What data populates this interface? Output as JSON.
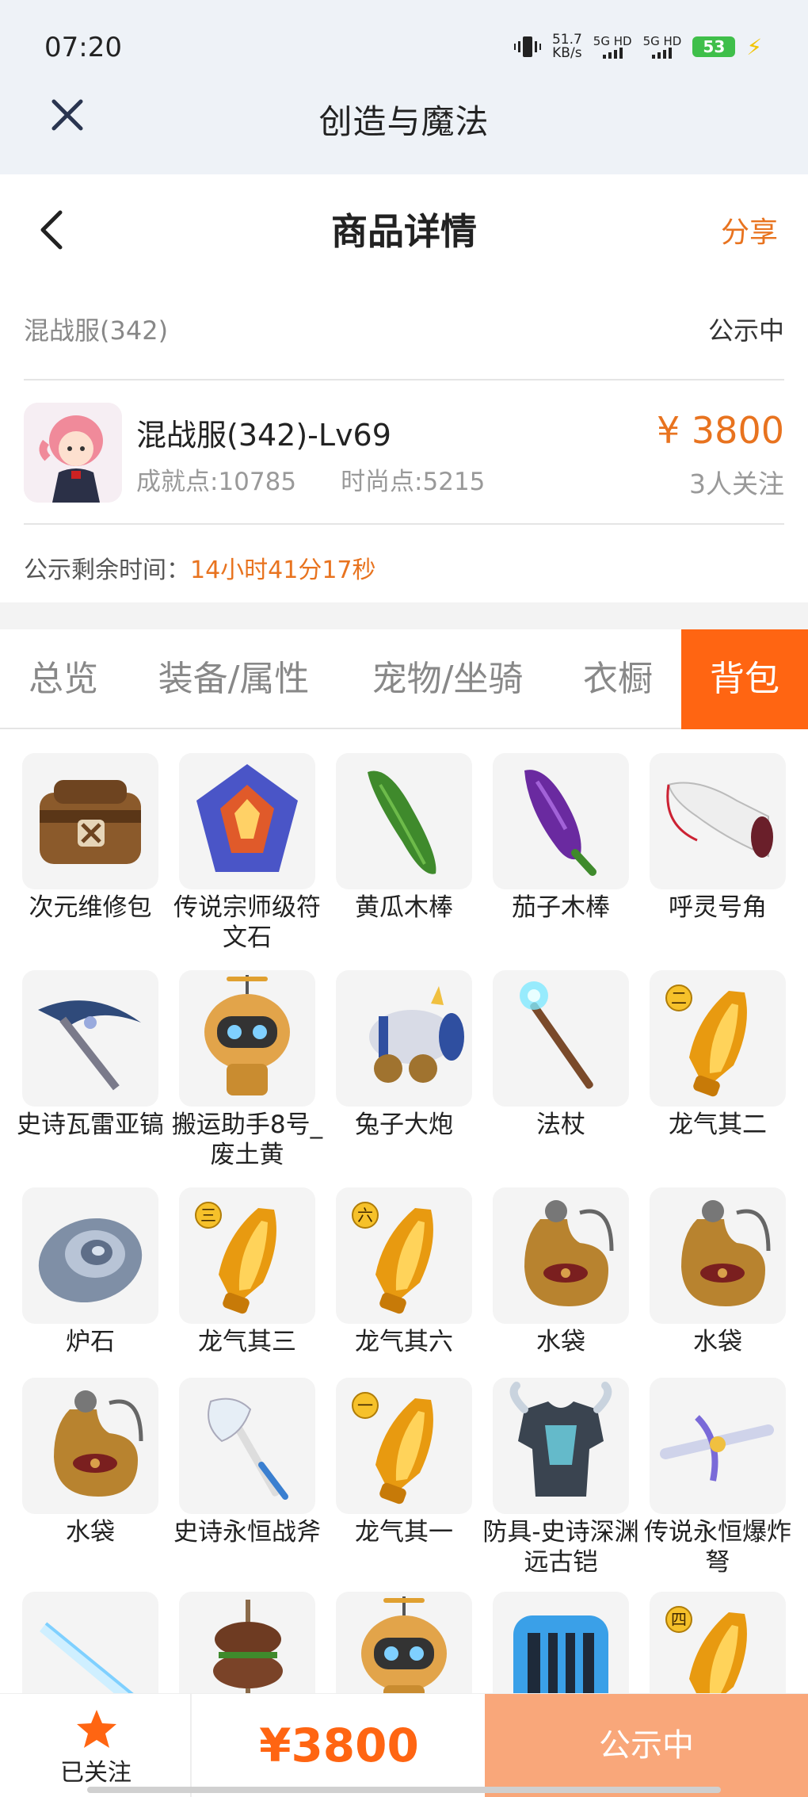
{
  "status_bar": {
    "time": "07:20",
    "speed_value": "51.7",
    "speed_unit": "KB/s",
    "sim1": "5G HD",
    "sim2": "5G HD",
    "battery": "53"
  },
  "app_bar": {
    "title": "创造与魔法"
  },
  "header": {
    "title": "商品详情",
    "share": "分享"
  },
  "listing": {
    "server": "混战服(342)",
    "status": "公示中",
    "character_name": "混战服(342)-Lv69",
    "achievement": "成就点:10785",
    "fashion": "时尚点:5215",
    "price": "¥ 3800",
    "followers": "3人关注",
    "remaining_label": "公示剩余时间：",
    "remaining_value": "14小时41分17秒"
  },
  "tabs": [
    "总览",
    "装备/属性",
    "宠物/坐骑",
    "衣橱",
    "背包"
  ],
  "active_tab": 4,
  "items": [
    {
      "label": "次元维修包",
      "icon": "repair-bag-icon",
      "badge": ""
    },
    {
      "label": "传说宗师级符文石",
      "icon": "rune-stone-icon",
      "badge": ""
    },
    {
      "label": "黄瓜木棒",
      "icon": "cucumber-club-icon",
      "badge": ""
    },
    {
      "label": "茄子木棒",
      "icon": "eggplant-club-icon",
      "badge": ""
    },
    {
      "label": "呼灵号角",
      "icon": "horn-icon",
      "badge": ""
    },
    {
      "label": "史诗瓦雷亚镐",
      "icon": "pickaxe-icon",
      "badge": ""
    },
    {
      "label": "搬运助手8号_废土黄",
      "icon": "robot-icon",
      "badge": ""
    },
    {
      "label": "兔子大炮",
      "icon": "cannon-icon",
      "badge": ""
    },
    {
      "label": "法杖",
      "icon": "staff-icon",
      "badge": ""
    },
    {
      "label": "龙气其二",
      "icon": "dragon-crystal-icon",
      "badge": "二"
    },
    {
      "label": "炉石",
      "icon": "hearthstone-icon",
      "badge": ""
    },
    {
      "label": "龙气其三",
      "icon": "dragon-crystal-icon",
      "badge": "三"
    },
    {
      "label": "龙气其六",
      "icon": "dragon-crystal-icon",
      "badge": "六"
    },
    {
      "label": "水袋",
      "icon": "water-bag-icon",
      "badge": ""
    },
    {
      "label": "水袋",
      "icon": "water-bag-icon",
      "badge": ""
    },
    {
      "label": "水袋",
      "icon": "water-bag-icon",
      "badge": ""
    },
    {
      "label": "史诗永恒战斧",
      "icon": "battle-axe-icon",
      "badge": ""
    },
    {
      "label": "龙气其一",
      "icon": "dragon-crystal-icon",
      "badge": "一"
    },
    {
      "label": "防具-史诗深渊远古铠",
      "icon": "armor-icon",
      "badge": ""
    },
    {
      "label": "传说永恒爆炸弩",
      "icon": "crossbow-icon",
      "badge": ""
    },
    {
      "label": "",
      "icon": "ice-sword-icon",
      "badge": ""
    },
    {
      "label": "",
      "icon": "kebab-icon",
      "badge": ""
    },
    {
      "label": "",
      "icon": "robot-icon",
      "badge": ""
    },
    {
      "label": "",
      "icon": "cage-icon",
      "badge": ""
    },
    {
      "label": "",
      "icon": "dragon-crystal-icon",
      "badge": "四"
    }
  ],
  "bottom_bar": {
    "follow_label": "已关注",
    "price": "¥3800",
    "action": "公示中"
  },
  "colors": {
    "accent": "#ff6512",
    "price": "#e8731f",
    "action_bg": "#f9a77a"
  }
}
